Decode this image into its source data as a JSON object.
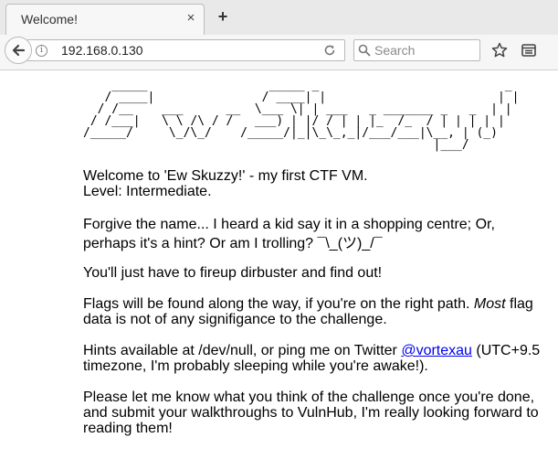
{
  "tab": {
    "title": "Welcome!",
    "close_glyph": "×",
    "new_tab_glyph": "+"
  },
  "navbar": {
    "url": "192.168.0.130",
    "search_placeholder": "Search",
    "info_glyph": "i"
  },
  "icons": {
    "back": "back-arrow-icon",
    "info": "info-icon",
    "reload": "reload-icon",
    "search": "search-icon",
    "bookmark": "star-icon",
    "reader": "reader-view-icon"
  },
  "colors": {
    "link": "#0000ee",
    "chrome_bg": "#f6f6f6",
    "tab_strip_bg": "#e9e9e9"
  },
  "page": {
    "ascii_banner": "    _____                 _____ _                          _ \n   / ____|               / ____| |                        | |\n  / /__    ___      __  \\___ \\| | ___   _ _______ _   _  | |\n / /___|   \\ \\ /\\ / /   ___) | |/ / | | |_  /_  / | | | | |\n/_____/     \\_/\\_/    /_____/|_|\\_\\_,_|/___/___|\\__, | (_)\n                                                 |___/    ",
    "intro_line1": "Welcome to 'Ew Skuzzy!' - my first CTF VM.",
    "intro_line2": "Level: Intermediate.",
    "forgive": "Forgive the name... I heard a kid say it in a shopping centre; Or, perhaps it's a hint? Or am I trolling? ¯\\_(ツ)_/¯",
    "dirbuster": "You'll just have to fireup dirbuster and find out!",
    "flags_before": "Flags will be found along the way, if you're on the right path. ",
    "flags_em": "Most",
    "flags_after": " flag data is not of any signifigance to the challenge.",
    "hints_before": "Hints available at /dev/null, or ping me on Twitter ",
    "hints_link": "@vortexau",
    "hints_after": " (UTC+9.5 timezone, I'm probably sleeping while you're awake!).",
    "please": "Please let me know what you think of the challenge once you're done, and submit your walkthroughs to VulnHub, I'm really looking forward to reading them!"
  }
}
